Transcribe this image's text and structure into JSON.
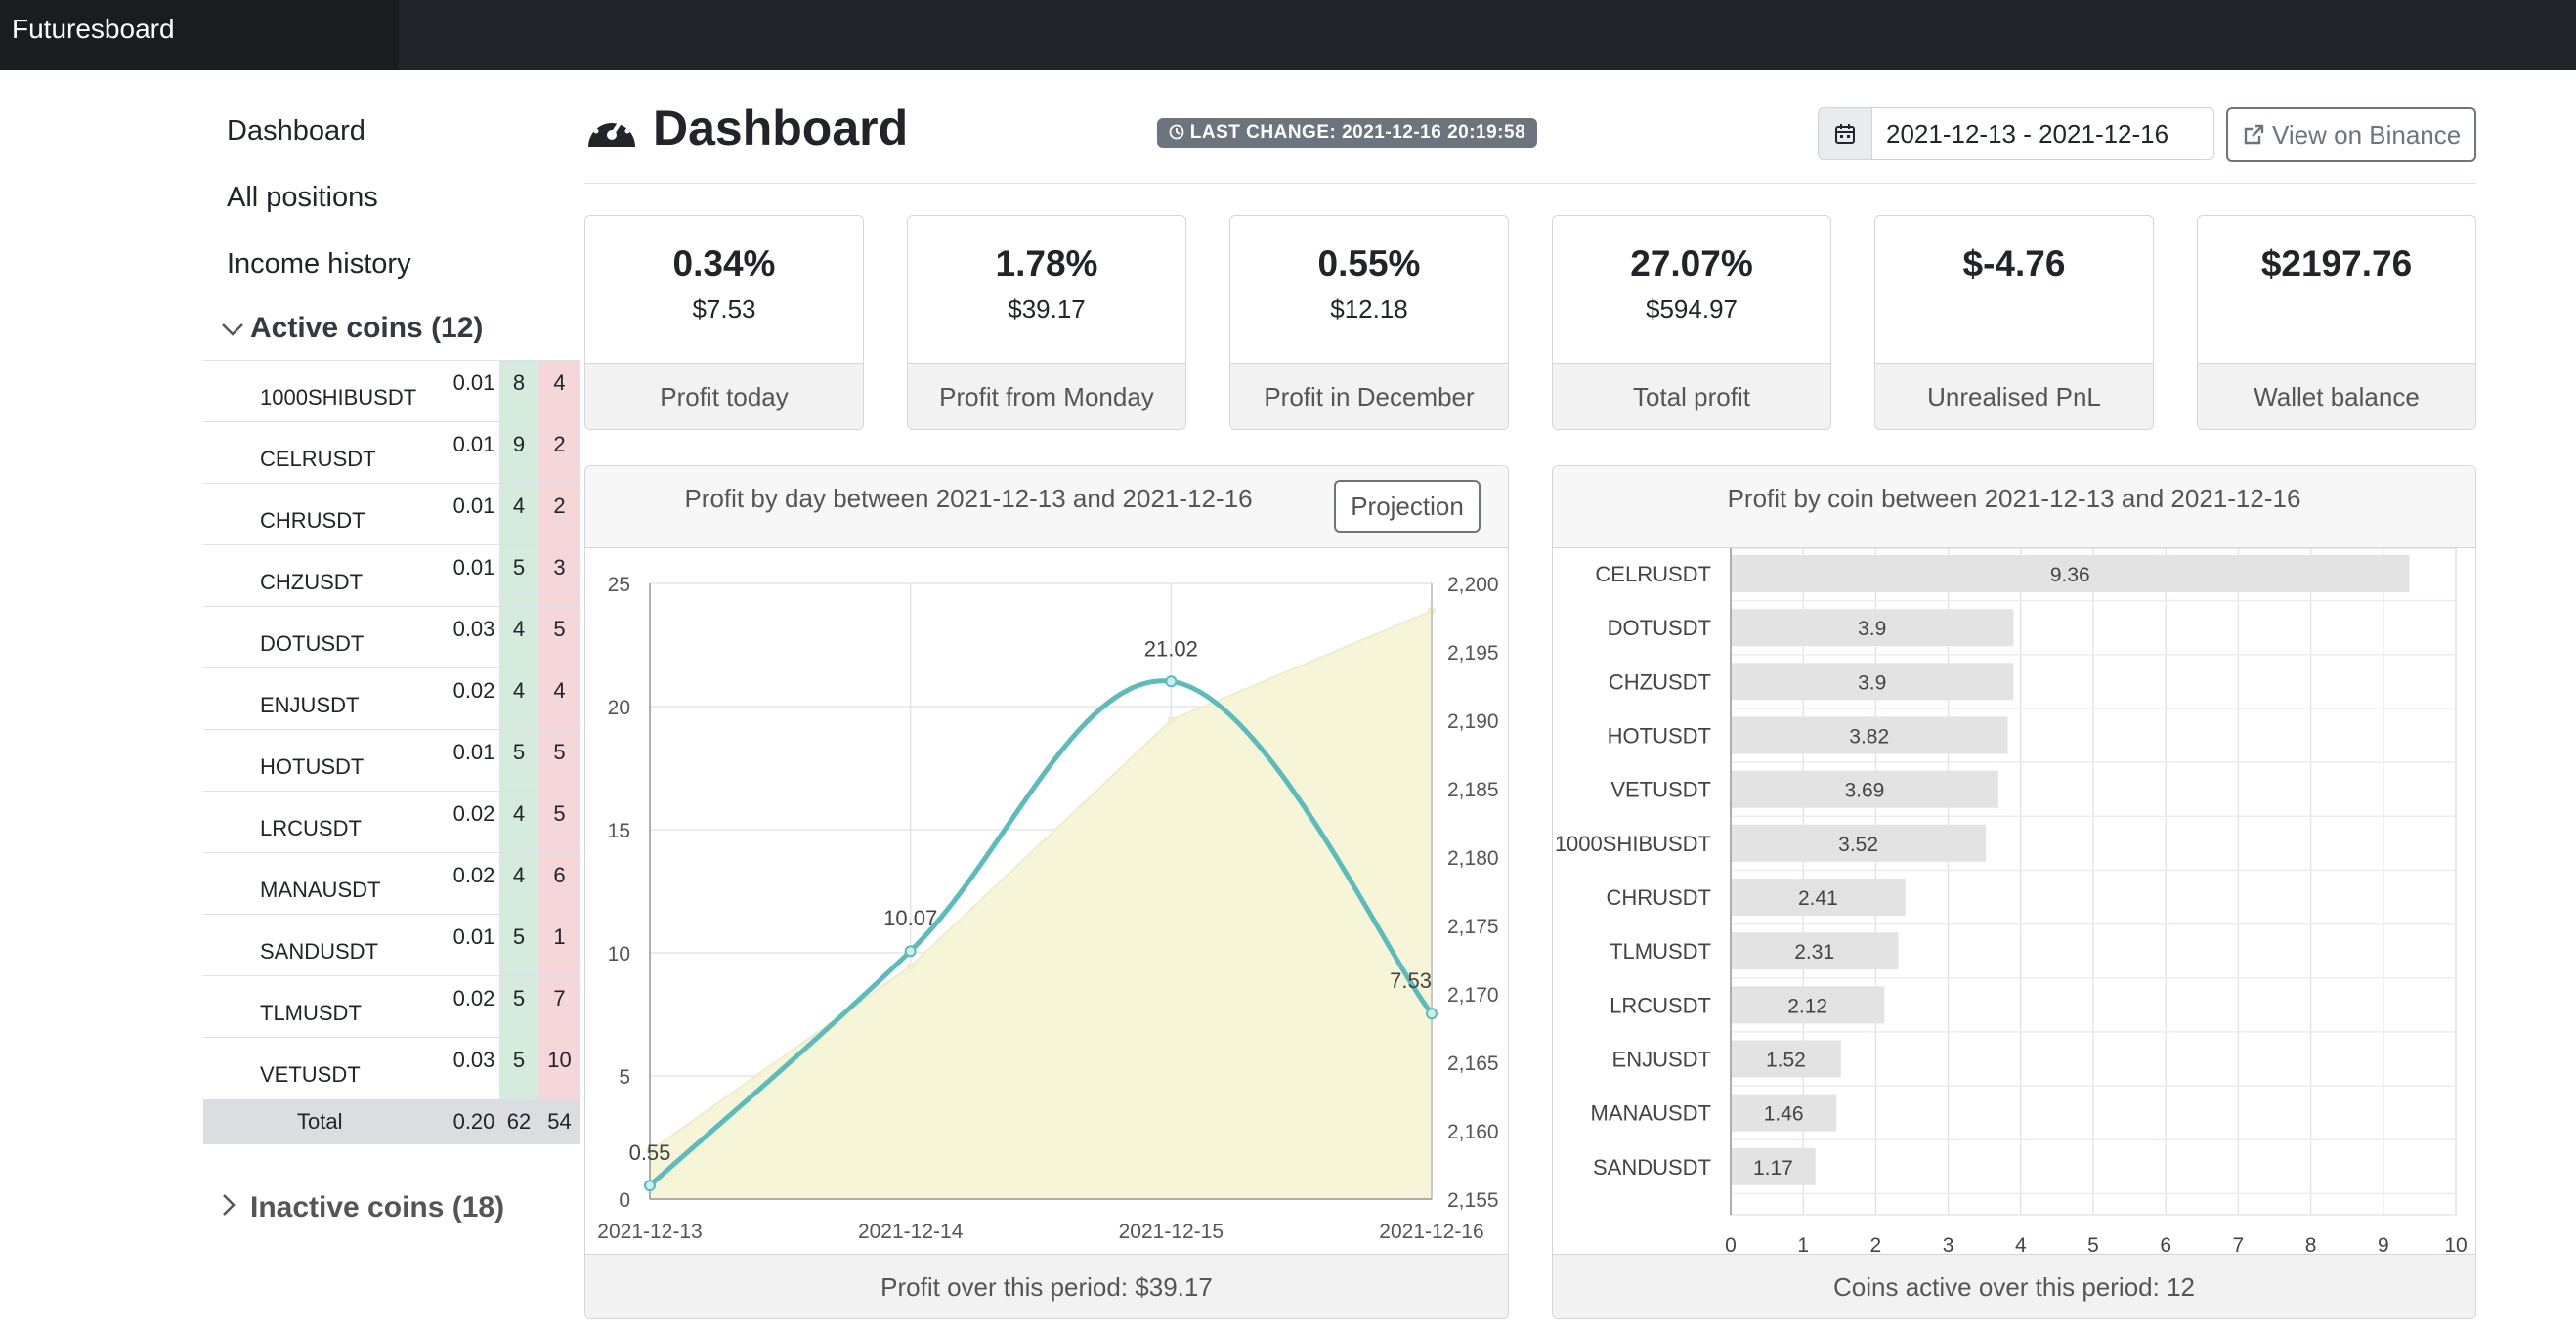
{
  "brand": "Futuresboard",
  "sidebar": {
    "links": [
      "Dashboard",
      "All positions",
      "Income history"
    ],
    "active_coins_label": "Active coins (12)",
    "inactive_coins_label": "Inactive coins (18)",
    "coins": [
      {
        "symbol": "1000SHIBUSDT",
        "qty": "0.01",
        "win": "8",
        "loss": "4"
      },
      {
        "symbol": "CELRUSDT",
        "qty": "0.01",
        "win": "9",
        "loss": "2"
      },
      {
        "symbol": "CHRUSDT",
        "qty": "0.01",
        "win": "4",
        "loss": "2"
      },
      {
        "symbol": "CHZUSDT",
        "qty": "0.01",
        "win": "5",
        "loss": "3"
      },
      {
        "symbol": "DOTUSDT",
        "qty": "0.03",
        "win": "4",
        "loss": "5"
      },
      {
        "symbol": "ENJUSDT",
        "qty": "0.02",
        "win": "4",
        "loss": "4"
      },
      {
        "symbol": "HOTUSDT",
        "qty": "0.01",
        "win": "5",
        "loss": "5"
      },
      {
        "symbol": "LRCUSDT",
        "qty": "0.02",
        "win": "4",
        "loss": "5"
      },
      {
        "symbol": "MANAUSDT",
        "qty": "0.02",
        "win": "4",
        "loss": "6"
      },
      {
        "symbol": "SANDUSDT",
        "qty": "0.01",
        "win": "5",
        "loss": "1"
      },
      {
        "symbol": "TLMUSDT",
        "qty": "0.02",
        "win": "5",
        "loss": "7"
      },
      {
        "symbol": "VETUSDT",
        "qty": "0.03",
        "win": "5",
        "loss": "10"
      }
    ],
    "total": {
      "label": "Total",
      "qty": "0.20",
      "win": "62",
      "loss": "54"
    }
  },
  "header": {
    "title": "Dashboard",
    "last_change": "LAST CHANGE: 2021-12-16 20:19:58",
    "date_range": "2021-12-13 - 2021-12-16",
    "binance_button": "View on Binance"
  },
  "cards": [
    {
      "pct": "0.34%",
      "amount": "$7.53",
      "label": "Profit today"
    },
    {
      "pct": "1.78%",
      "amount": "$39.17",
      "label": "Profit from Monday"
    },
    {
      "pct": "0.55%",
      "amount": "$12.18",
      "label": "Profit in December"
    },
    {
      "pct": "27.07%",
      "amount": "$594.97",
      "label": "Total profit"
    },
    {
      "pct": "$-4.76",
      "amount": "",
      "label": "Unrealised PnL"
    },
    {
      "pct": "$2197.76",
      "amount": "",
      "label": "Wallet balance"
    }
  ],
  "day_panel": {
    "title": "Profit by day between 2021-12-13 and 2021-12-16",
    "projection_button": "Projection",
    "footer": "Profit over this period: $39.17"
  },
  "coin_panel": {
    "title": "Profit by coin between 2021-12-13 and 2021-12-16",
    "footer": "Coins active over this period: 12"
  },
  "colors": {
    "line": "#5bbcbc",
    "area": "#f7f5d8",
    "bar": "#e3e3e3",
    "win_bg": "#d4ebdd",
    "loss_bg": "#f5d6d9"
  },
  "chart_data": [
    {
      "type": "line",
      "x": [
        "2021-12-13",
        "2021-12-14",
        "2021-12-15",
        "2021-12-16"
      ],
      "series": [
        {
          "values": [
            0.55,
            10.07,
            21.02,
            7.53
          ],
          "axis": "left"
        },
        {
          "values": [
            2158.5,
            2172,
            2190,
            2198
          ],
          "axis": "right",
          "type": "area"
        }
      ],
      "data_labels": [
        "0.55",
        "10.07",
        "21.02",
        "7.53"
      ],
      "ylim_left": [
        0,
        25
      ],
      "ylim_right": [
        2155,
        2200
      ],
      "yticks_left": [
        "0",
        "5",
        "10",
        "15",
        "20",
        "25"
      ],
      "yticks_right": [
        "2,155",
        "2,160",
        "2,165",
        "2,170",
        "2,175",
        "2,180",
        "2,185",
        "2,190",
        "2,195",
        "2,200"
      ],
      "grid": true
    },
    {
      "type": "bar",
      "orientation": "horizontal",
      "categories": [
        "CELRUSDT",
        "DOTUSDT",
        "CHZUSDT",
        "HOTUSDT",
        "VETUSDT",
        "1000SHIBUSDT",
        "CHRUSDT",
        "TLMUSDT",
        "LRCUSDT",
        "ENJUSDT",
        "MANAUSDT",
        "SANDUSDT"
      ],
      "values": [
        9.36,
        3.9,
        3.9,
        3.82,
        3.69,
        3.52,
        2.41,
        2.31,
        2.12,
        1.52,
        1.46,
        1.17
      ],
      "xlim": [
        0,
        10
      ],
      "xticks": [
        "0",
        "1",
        "2",
        "3",
        "4",
        "5",
        "6",
        "7",
        "8",
        "9",
        "10"
      ],
      "grid": true
    }
  ]
}
